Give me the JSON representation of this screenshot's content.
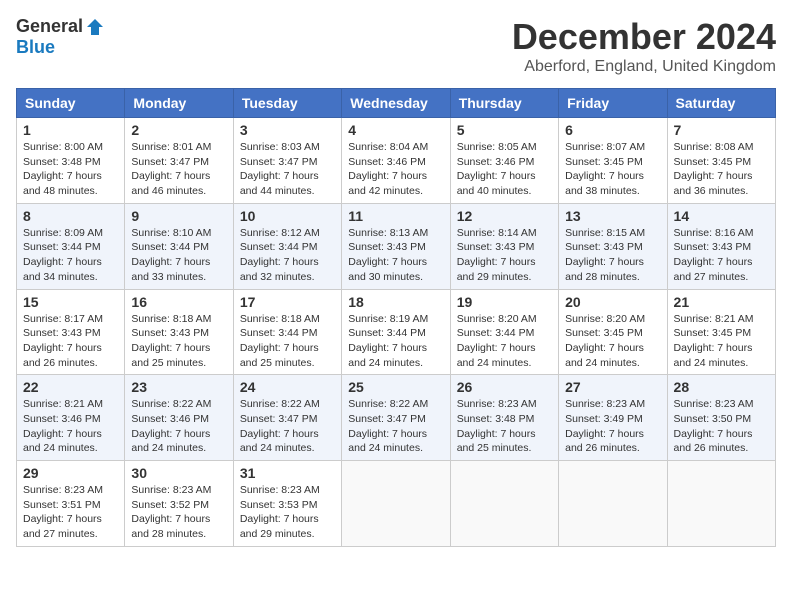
{
  "logo": {
    "general": "General",
    "blue": "Blue"
  },
  "title": "December 2024",
  "location": "Aberford, England, United Kingdom",
  "days_of_week": [
    "Sunday",
    "Monday",
    "Tuesday",
    "Wednesday",
    "Thursday",
    "Friday",
    "Saturday"
  ],
  "weeks": [
    [
      {
        "day": "1",
        "sunrise": "Sunrise: 8:00 AM",
        "sunset": "Sunset: 3:48 PM",
        "daylight": "Daylight: 7 hours and 48 minutes."
      },
      {
        "day": "2",
        "sunrise": "Sunrise: 8:01 AM",
        "sunset": "Sunset: 3:47 PM",
        "daylight": "Daylight: 7 hours and 46 minutes."
      },
      {
        "day": "3",
        "sunrise": "Sunrise: 8:03 AM",
        "sunset": "Sunset: 3:47 PM",
        "daylight": "Daylight: 7 hours and 44 minutes."
      },
      {
        "day": "4",
        "sunrise": "Sunrise: 8:04 AM",
        "sunset": "Sunset: 3:46 PM",
        "daylight": "Daylight: 7 hours and 42 minutes."
      },
      {
        "day": "5",
        "sunrise": "Sunrise: 8:05 AM",
        "sunset": "Sunset: 3:46 PM",
        "daylight": "Daylight: 7 hours and 40 minutes."
      },
      {
        "day": "6",
        "sunrise": "Sunrise: 8:07 AM",
        "sunset": "Sunset: 3:45 PM",
        "daylight": "Daylight: 7 hours and 38 minutes."
      },
      {
        "day": "7",
        "sunrise": "Sunrise: 8:08 AM",
        "sunset": "Sunset: 3:45 PM",
        "daylight": "Daylight: 7 hours and 36 minutes."
      }
    ],
    [
      {
        "day": "8",
        "sunrise": "Sunrise: 8:09 AM",
        "sunset": "Sunset: 3:44 PM",
        "daylight": "Daylight: 7 hours and 34 minutes."
      },
      {
        "day": "9",
        "sunrise": "Sunrise: 8:10 AM",
        "sunset": "Sunset: 3:44 PM",
        "daylight": "Daylight: 7 hours and 33 minutes."
      },
      {
        "day": "10",
        "sunrise": "Sunrise: 8:12 AM",
        "sunset": "Sunset: 3:44 PM",
        "daylight": "Daylight: 7 hours and 32 minutes."
      },
      {
        "day": "11",
        "sunrise": "Sunrise: 8:13 AM",
        "sunset": "Sunset: 3:43 PM",
        "daylight": "Daylight: 7 hours and 30 minutes."
      },
      {
        "day": "12",
        "sunrise": "Sunrise: 8:14 AM",
        "sunset": "Sunset: 3:43 PM",
        "daylight": "Daylight: 7 hours and 29 minutes."
      },
      {
        "day": "13",
        "sunrise": "Sunrise: 8:15 AM",
        "sunset": "Sunset: 3:43 PM",
        "daylight": "Daylight: 7 hours and 28 minutes."
      },
      {
        "day": "14",
        "sunrise": "Sunrise: 8:16 AM",
        "sunset": "Sunset: 3:43 PM",
        "daylight": "Daylight: 7 hours and 27 minutes."
      }
    ],
    [
      {
        "day": "15",
        "sunrise": "Sunrise: 8:17 AM",
        "sunset": "Sunset: 3:43 PM",
        "daylight": "Daylight: 7 hours and 26 minutes."
      },
      {
        "day": "16",
        "sunrise": "Sunrise: 8:18 AM",
        "sunset": "Sunset: 3:43 PM",
        "daylight": "Daylight: 7 hours and 25 minutes."
      },
      {
        "day": "17",
        "sunrise": "Sunrise: 8:18 AM",
        "sunset": "Sunset: 3:44 PM",
        "daylight": "Daylight: 7 hours and 25 minutes."
      },
      {
        "day": "18",
        "sunrise": "Sunrise: 8:19 AM",
        "sunset": "Sunset: 3:44 PM",
        "daylight": "Daylight: 7 hours and 24 minutes."
      },
      {
        "day": "19",
        "sunrise": "Sunrise: 8:20 AM",
        "sunset": "Sunset: 3:44 PM",
        "daylight": "Daylight: 7 hours and 24 minutes."
      },
      {
        "day": "20",
        "sunrise": "Sunrise: 8:20 AM",
        "sunset": "Sunset: 3:45 PM",
        "daylight": "Daylight: 7 hours and 24 minutes."
      },
      {
        "day": "21",
        "sunrise": "Sunrise: 8:21 AM",
        "sunset": "Sunset: 3:45 PM",
        "daylight": "Daylight: 7 hours and 24 minutes."
      }
    ],
    [
      {
        "day": "22",
        "sunrise": "Sunrise: 8:21 AM",
        "sunset": "Sunset: 3:46 PM",
        "daylight": "Daylight: 7 hours and 24 minutes."
      },
      {
        "day": "23",
        "sunrise": "Sunrise: 8:22 AM",
        "sunset": "Sunset: 3:46 PM",
        "daylight": "Daylight: 7 hours and 24 minutes."
      },
      {
        "day": "24",
        "sunrise": "Sunrise: 8:22 AM",
        "sunset": "Sunset: 3:47 PM",
        "daylight": "Daylight: 7 hours and 24 minutes."
      },
      {
        "day": "25",
        "sunrise": "Sunrise: 8:22 AM",
        "sunset": "Sunset: 3:47 PM",
        "daylight": "Daylight: 7 hours and 24 minutes."
      },
      {
        "day": "26",
        "sunrise": "Sunrise: 8:23 AM",
        "sunset": "Sunset: 3:48 PM",
        "daylight": "Daylight: 7 hours and 25 minutes."
      },
      {
        "day": "27",
        "sunrise": "Sunrise: 8:23 AM",
        "sunset": "Sunset: 3:49 PM",
        "daylight": "Daylight: 7 hours and 26 minutes."
      },
      {
        "day": "28",
        "sunrise": "Sunrise: 8:23 AM",
        "sunset": "Sunset: 3:50 PM",
        "daylight": "Daylight: 7 hours and 26 minutes."
      }
    ],
    [
      {
        "day": "29",
        "sunrise": "Sunrise: 8:23 AM",
        "sunset": "Sunset: 3:51 PM",
        "daylight": "Daylight: 7 hours and 27 minutes."
      },
      {
        "day": "30",
        "sunrise": "Sunrise: 8:23 AM",
        "sunset": "Sunset: 3:52 PM",
        "daylight": "Daylight: 7 hours and 28 minutes."
      },
      {
        "day": "31",
        "sunrise": "Sunrise: 8:23 AM",
        "sunset": "Sunset: 3:53 PM",
        "daylight": "Daylight: 7 hours and 29 minutes."
      },
      null,
      null,
      null,
      null
    ]
  ]
}
